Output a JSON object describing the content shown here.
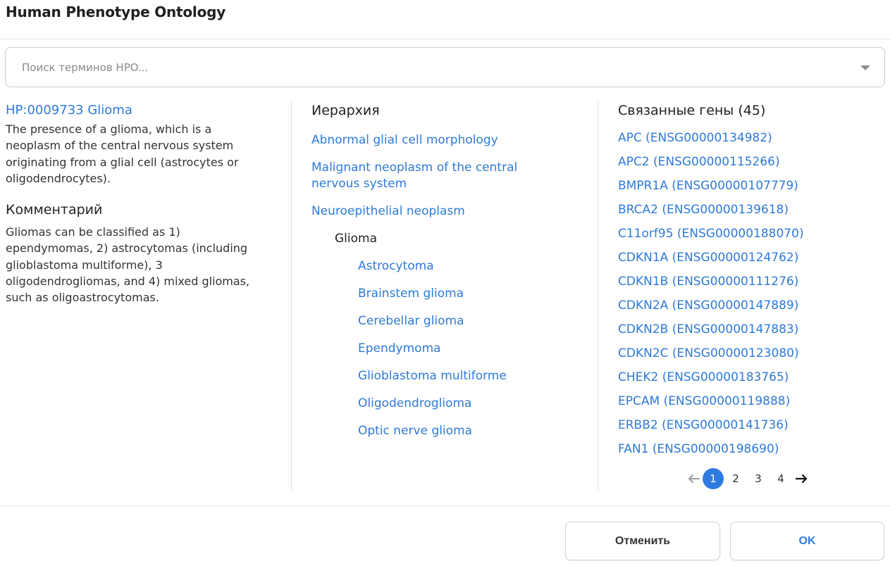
{
  "dialog": {
    "title": "Human Phenotype Ontology"
  },
  "search": {
    "placeholder": "Поиск терминов HPO..."
  },
  "term": {
    "link": "HP:0009733 Glioma",
    "description": "The presence of a glioma, which is a neoplasm of the central nervous system originating from a glial cell (astrocytes or oligodendrocytes).",
    "comment_heading": "Комментарий",
    "comment": "Gliomas can be classified as 1) ependymomas, 2) astrocytomas (including glioblastoma multiforme), 3 oligodendrogliomas, and 4) mixed gliomas, such as oligoastrocytomas."
  },
  "hierarchy": {
    "heading": "Иерархия",
    "ancestors": [
      "Abnormal glial cell morphology",
      "Malignant neoplasm of the central nervous system",
      "Neuroepithelial neoplasm"
    ],
    "current": "Glioma",
    "children": [
      "Astrocytoma",
      "Brainstem glioma",
      "Cerebellar glioma",
      "Ependymoma",
      "Glioblastoma multiforme",
      "Oligodendroglioma",
      "Optic nerve glioma"
    ]
  },
  "genes": {
    "heading": "Связанные гены (45)",
    "items": [
      "APC (ENSG00000134982)",
      "APC2 (ENSG00000115266)",
      "BMPR1A (ENSG00000107779)",
      "BRCA2 (ENSG00000139618)",
      "C11orf95 (ENSG00000188070)",
      "CDKN1A (ENSG00000124762)",
      "CDKN1B (ENSG00000111276)",
      "CDKN2A (ENSG00000147889)",
      "CDKN2B (ENSG00000147883)",
      "CDKN2C (ENSG00000123080)",
      "CHEK2 (ENSG00000183765)",
      "EPCAM (ENSG00000119888)",
      "ERBB2 (ENSG00000141736)",
      "FAN1 (ENSG00000198690)"
    ]
  },
  "pagination": {
    "pages": [
      "1",
      "2",
      "3",
      "4"
    ],
    "current_page": "1",
    "prev_icon": "arrow-left-icon",
    "next_icon": "arrow-right-icon"
  },
  "footer": {
    "cancel_label": "Отменить",
    "ok_label": "OK"
  },
  "colors": {
    "link": "#2e7ad6",
    "accent": "#2f7ce0",
    "text": "#222222"
  }
}
